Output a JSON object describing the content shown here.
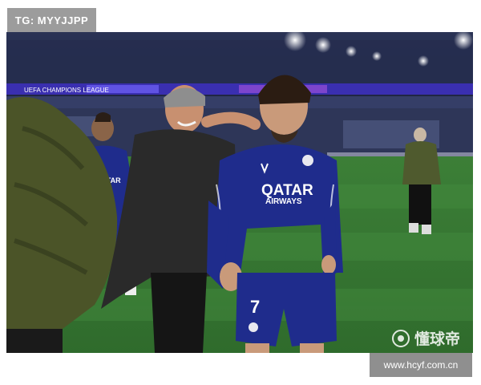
{
  "overlay": {
    "tg_label": "TG: MYYJJPP",
    "url": "www.hcyf.com.cn"
  },
  "photo": {
    "led_board_text": "UEFA CHAMPIONS LEAGUE",
    "shirt_sponsor_line1": "QATAR",
    "shirt_sponsor_line2": "AIRWAYS",
    "shirt_number": "7",
    "background_player_sponsor": "QATAR",
    "watermark_text": "懂球帝"
  },
  "colors": {
    "kit_blue": "#1f2c8c",
    "pitch_green": "#3f8a3a",
    "coat_olive": "#4f5a2e",
    "stand_dark": "#1b2140"
  }
}
